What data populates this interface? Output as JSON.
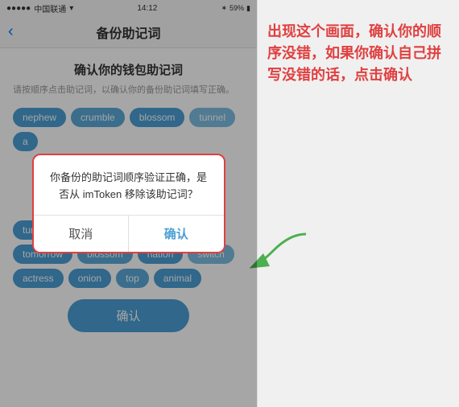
{
  "status": {
    "carrier": "中国联通",
    "time": "14:12",
    "battery": "59%"
  },
  "nav": {
    "title": "备份助记词",
    "back_icon": "‹"
  },
  "page": {
    "title": "确认你的钱包助记词",
    "desc": "请按顺序点击助记词，以确认你的备份助记词填写正确。"
  },
  "words": {
    "row1": [
      "nephew",
      "crumble",
      "blossom",
      "tunnel"
    ],
    "row2_partial": [
      "a"
    ],
    "row3_partial": [
      "tun"
    ],
    "row4": [
      "tomorrow",
      "blossom",
      "nation",
      "switch"
    ],
    "row5": [
      "actress",
      "onion",
      "top",
      "animal"
    ]
  },
  "dialog": {
    "message": "你备份的助记词顺序验证正确，是否从 imToken 移除该助记词？",
    "cancel_label": "取消",
    "confirm_label": "确认"
  },
  "confirm_button": "确认",
  "annotation": {
    "text": "出现这个画面，确认你的顺序没错，如果你确认自己拼写没错的话，点击确认"
  }
}
